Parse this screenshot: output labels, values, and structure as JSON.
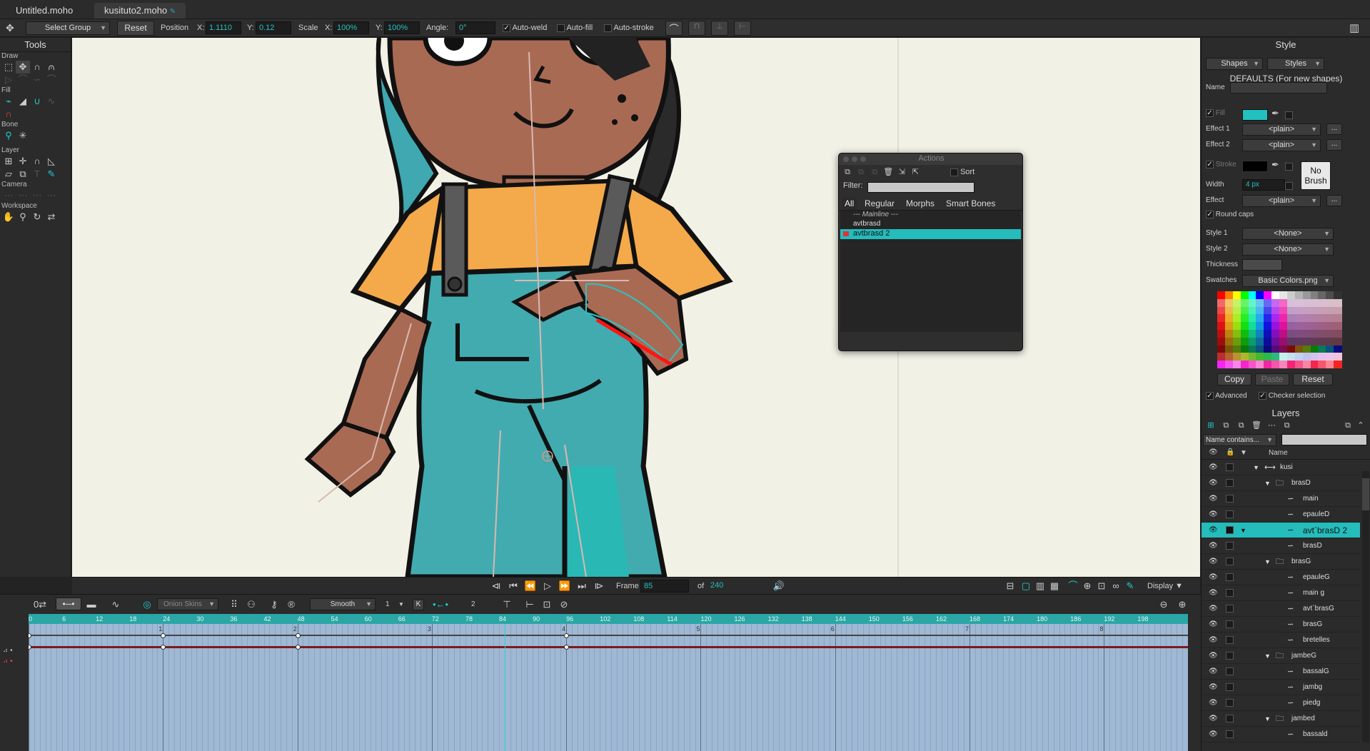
{
  "tabs": [
    {
      "label": "Untitled.moho"
    },
    {
      "label": "kusituto2.moho"
    }
  ],
  "options": {
    "tool_mode": "Select Group",
    "reset": "Reset",
    "position_label": "Position",
    "x_label": "X:",
    "x_value": "1.1110",
    "y_label": "Y:",
    "y_value": "0.12",
    "scale_label": "Scale",
    "scale_x_label": "X:",
    "scale_x": "100%",
    "scale_y_label": "Y:",
    "scale_y": "100%",
    "angle_label": "Angle:",
    "angle_value": "0°",
    "auto_weld": "Auto-weld",
    "auto_fill": "Auto-fill",
    "auto_stroke": "Auto-stroke"
  },
  "tools": {
    "title": "Tools",
    "sections": [
      "Draw",
      "Fill",
      "Bone",
      "Layer",
      "Camera",
      "Workspace"
    ]
  },
  "actions": {
    "title": "Actions",
    "sort": "Sort",
    "filter_label": "Filter:",
    "tabs": [
      "All",
      "Regular",
      "Morphs",
      "Smart Bones"
    ],
    "items": [
      "--- Mainline ---",
      "avtbrasd",
      "avtbrasd 2"
    ]
  },
  "style": {
    "title": "Style",
    "shapes_btn": "Shapes",
    "styles_btn": "Styles",
    "defaults": "DEFAULTS (For new shapes)",
    "name_label": "Name",
    "fill_label": "Fill",
    "fill_color": "#23c0c0",
    "effect1_label": "Effect 1",
    "effect1_value": "<plain>",
    "effect2_label": "Effect 2",
    "effect2_value": "<plain>",
    "stroke_label": "Stroke",
    "stroke_color": "#000000",
    "no_brush": "No Brush",
    "width_label": "Width",
    "width_value": "4 px",
    "effect_label": "Effect",
    "effect_value": "<plain>",
    "round_caps": "Round caps",
    "style1_label": "Style 1",
    "style1_value": "<None>",
    "style2_label": "Style 2",
    "style2_value": "<None>",
    "thickness_label": "Thickness",
    "swatches_label": "Swatches",
    "swatches_value": "Basic Colors.png",
    "copy": "Copy",
    "paste": "Paste",
    "reset": "Reset",
    "advanced": "Advanced",
    "checker": "Checker selection"
  },
  "layers": {
    "title": "Layers",
    "filter_mode": "Name contains...",
    "col_name": "Name",
    "rows": [
      {
        "name": "kusi",
        "indent": 0,
        "kind": "bone"
      },
      {
        "name": "brasD",
        "indent": 1,
        "kind": "group"
      },
      {
        "name": "main",
        "indent": 2,
        "kind": "vector"
      },
      {
        "name": "epauleD",
        "indent": 2,
        "kind": "vector"
      },
      {
        "name": "avt`brasD 2",
        "indent": 2,
        "kind": "vector",
        "active": true
      },
      {
        "name": "brasD",
        "indent": 2,
        "kind": "vector"
      },
      {
        "name": "brasG",
        "indent": 1,
        "kind": "group"
      },
      {
        "name": "epauleG",
        "indent": 2,
        "kind": "vector"
      },
      {
        "name": "main g",
        "indent": 2,
        "kind": "vector"
      },
      {
        "name": "avt`brasG",
        "indent": 2,
        "kind": "vector"
      },
      {
        "name": "brasG",
        "indent": 2,
        "kind": "vector"
      },
      {
        "name": "bretelles",
        "indent": 2,
        "kind": "vector"
      },
      {
        "name": "jambeG",
        "indent": 1,
        "kind": "group"
      },
      {
        "name": "bassalG",
        "indent": 2,
        "kind": "vector"
      },
      {
        "name": "jambg",
        "indent": 2,
        "kind": "vector"
      },
      {
        "name": "piedg",
        "indent": 2,
        "kind": "vector"
      },
      {
        "name": "jambed",
        "indent": 1,
        "kind": "group"
      },
      {
        "name": "bassald",
        "indent": 2,
        "kind": "vector"
      }
    ]
  },
  "playback": {
    "frame_label": "Frame",
    "frame_value": "85",
    "of_label": "of",
    "total": "240",
    "display": "Display"
  },
  "timeline": {
    "onion": "Onion Skins",
    "interp": "Smooth",
    "interp_n": "1",
    "key_label": "K",
    "step": "2",
    "ruler": [
      "0",
      "6",
      "12",
      "18",
      "24",
      "30",
      "36",
      "42",
      "48",
      "54",
      "60",
      "66",
      "72",
      "78",
      "84",
      "90",
      "96",
      "102",
      "108",
      "114",
      "120",
      "126",
      "132",
      "138",
      "144",
      "150",
      "156",
      "162",
      "168",
      "174",
      "180",
      "186",
      "192",
      "198"
    ],
    "seconds": [
      "1",
      "2",
      "3",
      "4",
      "5",
      "6",
      "7",
      "8"
    ]
  }
}
